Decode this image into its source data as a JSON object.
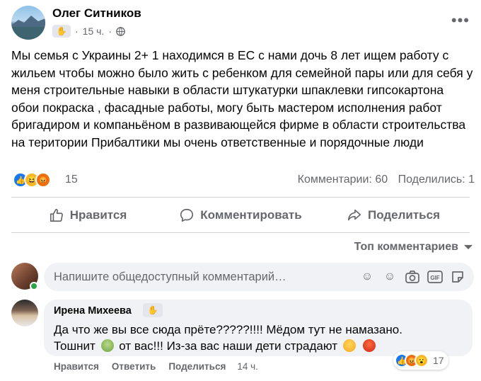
{
  "post": {
    "author": "Олег Ситников",
    "time": "15 ч.",
    "audience_icon": "globe-icon",
    "text": "Мы семья с Украины 2+ 1 находимся в ЕС с нами дочь 8 лет ищем работу с жильем чтобы можно было жить с ребенком для семейной пары или для себя у меня строительные навыки в области штукатурки шпаклевки гипсокартона обои покраска , фасадные работы, могу быть мастером исполнения работ бригадиром и компаньёном в развивающейся фирме в области строительства на територии Прибалтики мы очень ответственные и порядочные люди",
    "reaction_count": "15",
    "comments_label": "Комментарии: 60",
    "shares_label": "Поделились: 1"
  },
  "actions": {
    "like": "Нравится",
    "comment": "Комментировать",
    "share": "Поделиться"
  },
  "sort_label": "Топ комментариев",
  "composer": {
    "placeholder": "Напишите общедоступный комментарий…"
  },
  "comment": {
    "author": "Ирена Михеева",
    "line1": "Да что же вы все сюда прёте?????!!!! Мёдом тут не намазано.",
    "line2a": "Тошнит",
    "line2b": "от вас!!! Из-за вас наши дети страдают",
    "reaction_count": "17",
    "like": "Нравится",
    "reply": "Ответить",
    "share": "Поделиться",
    "time": "14 ч."
  },
  "colors": {
    "accent": "#1877f2",
    "muted": "#65676b",
    "bubble": "#f0f2f5",
    "online": "#31a24c"
  }
}
